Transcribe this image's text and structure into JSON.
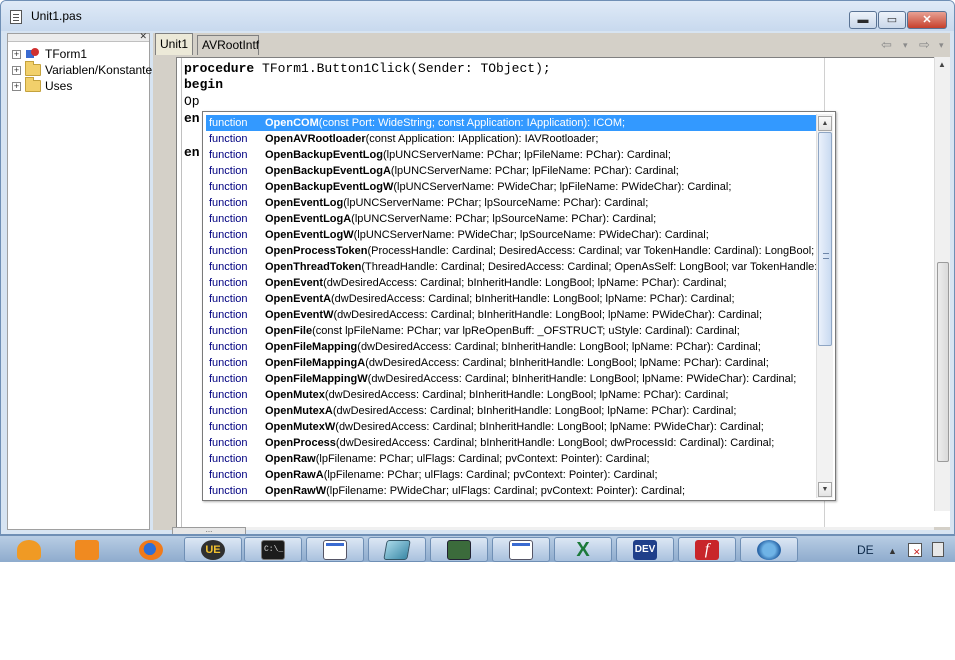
{
  "window": {
    "title": "Unit1.pas",
    "controls": {
      "minimize": "▬",
      "maximize": "▭",
      "close": "✕"
    }
  },
  "tree": {
    "header_close": "✕",
    "items": [
      {
        "label": "TForm1",
        "icon": "form-icon",
        "expander": "+"
      },
      {
        "label": "Variablen/Konstante",
        "icon": "folder-icon",
        "expander": "+"
      },
      {
        "label": "Uses",
        "icon": "folder-icon",
        "expander": "+"
      }
    ]
  },
  "editor": {
    "tabs": [
      "Unit1",
      "AVRootIntf"
    ],
    "nav": {
      "back": "⇦",
      "back_drop": "▾",
      "forward": "⇨",
      "forward_drop": "▾"
    },
    "lines": [
      {
        "keyword": "procedure",
        "rest": " TForm1.Button1Click(Sender: TObject);"
      },
      {
        "keyword": "begin",
        "rest": ""
      },
      {
        "keyword": "",
        "rest": "Op"
      },
      {
        "keyword": "en",
        "rest": ""
      },
      {
        "keyword": "",
        "rest": ""
      },
      {
        "keyword": "en",
        "rest": ""
      }
    ],
    "hscroll_grip": "..."
  },
  "completion": {
    "selected_index": 0,
    "items": [
      {
        "kind": "function",
        "name": "OpenCOM",
        "params": "(const Port: WideString; const Application: IApplication): ICOM;"
      },
      {
        "kind": "function",
        "name": "OpenAVRootloader",
        "params": "(const Application: IApplication): IAVRootloader;"
      },
      {
        "kind": "function",
        "name": "OpenBackupEventLog",
        "params": "(lpUNCServerName: PChar; lpFileName: PChar): Cardinal;"
      },
      {
        "kind": "function",
        "name": "OpenBackupEventLogA",
        "params": "(lpUNCServerName: PChar; lpFileName: PChar): Cardinal;"
      },
      {
        "kind": "function",
        "name": "OpenBackupEventLogW",
        "params": "(lpUNCServerName: PWideChar; lpFileName: PWideChar): Cardinal;"
      },
      {
        "kind": "function",
        "name": "OpenEventLog",
        "params": "(lpUNCServerName: PChar; lpSourceName: PChar): Cardinal;"
      },
      {
        "kind": "function",
        "name": "OpenEventLogA",
        "params": "(lpUNCServerName: PChar; lpSourceName: PChar): Cardinal;"
      },
      {
        "kind": "function",
        "name": "OpenEventLogW",
        "params": "(lpUNCServerName: PWideChar; lpSourceName: PWideChar): Cardinal;"
      },
      {
        "kind": "function",
        "name": "OpenProcessToken",
        "params": "(ProcessHandle: Cardinal; DesiredAccess: Cardinal; var TokenHandle: Cardinal): LongBool;"
      },
      {
        "kind": "function",
        "name": "OpenThreadToken",
        "params": "(ThreadHandle: Cardinal; DesiredAccess: Cardinal; OpenAsSelf: LongBool; var TokenHandle:"
      },
      {
        "kind": "function",
        "name": "OpenEvent",
        "params": "(dwDesiredAccess: Cardinal; bInheritHandle: LongBool; lpName: PChar): Cardinal;"
      },
      {
        "kind": "function",
        "name": "OpenEventA",
        "params": "(dwDesiredAccess: Cardinal; bInheritHandle: LongBool; lpName: PChar): Cardinal;"
      },
      {
        "kind": "function",
        "name": "OpenEventW",
        "params": "(dwDesiredAccess: Cardinal; bInheritHandle: LongBool; lpName: PWideChar): Cardinal;"
      },
      {
        "kind": "function",
        "name": "OpenFile",
        "params": "(const lpFileName: PChar; var lpReOpenBuff: _OFSTRUCT; uStyle: Cardinal): Cardinal;"
      },
      {
        "kind": "function",
        "name": "OpenFileMapping",
        "params": "(dwDesiredAccess: Cardinal; bInheritHandle: LongBool; lpName: PChar): Cardinal;"
      },
      {
        "kind": "function",
        "name": "OpenFileMappingA",
        "params": "(dwDesiredAccess: Cardinal; bInheritHandle: LongBool; lpName: PChar): Cardinal;"
      },
      {
        "kind": "function",
        "name": "OpenFileMappingW",
        "params": "(dwDesiredAccess: Cardinal; bInheritHandle: LongBool; lpName: PWideChar): Cardinal;"
      },
      {
        "kind": "function",
        "name": "OpenMutex",
        "params": "(dwDesiredAccess: Cardinal; bInheritHandle: LongBool; lpName: PChar): Cardinal;"
      },
      {
        "kind": "function",
        "name": "OpenMutexA",
        "params": "(dwDesiredAccess: Cardinal; bInheritHandle: LongBool; lpName: PChar): Cardinal;"
      },
      {
        "kind": "function",
        "name": "OpenMutexW",
        "params": "(dwDesiredAccess: Cardinal; bInheritHandle: LongBool; lpName: PWideChar): Cardinal;"
      },
      {
        "kind": "function",
        "name": "OpenProcess",
        "params": "(dwDesiredAccess: Cardinal; bInheritHandle: LongBool; dwProcessId: Cardinal): Cardinal;"
      },
      {
        "kind": "function",
        "name": "OpenRaw",
        "params": "(lpFilename: PChar; ulFlags: Cardinal; pvContext: Pointer): Cardinal;"
      },
      {
        "kind": "function",
        "name": "OpenRawA",
        "params": "(lpFilename: PChar; ulFlags: Cardinal; pvContext: Pointer): Cardinal;"
      },
      {
        "kind": "function",
        "name": "OpenRawW",
        "params": "(lpFilename: PWideChar; ulFlags: Cardinal; pvContext: Pointer): Cardinal;"
      }
    ],
    "scroll": {
      "up": "▲",
      "down": "▼",
      "grip": "≡"
    }
  },
  "taskbar": {
    "ultraedit_glyph": "UE",
    "cmd_glyph": "C:\\_",
    "excel_glyph": "X",
    "dev_glyph": "DEV",
    "flash_glyph": "f",
    "language": "DE",
    "tray_arrow": "▲"
  },
  "colors": {
    "selection": "#3399ff",
    "kind_text": "#000080",
    "title_bar": "#c8d9ee"
  }
}
